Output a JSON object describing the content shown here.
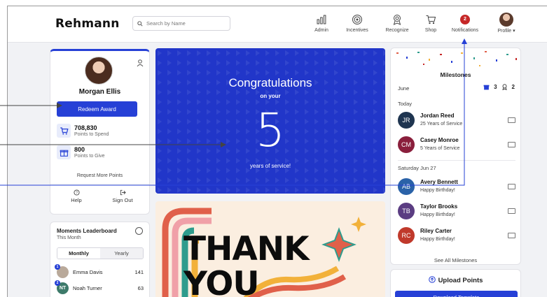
{
  "brand": {
    "logo": "Rehmann",
    "accent": "#2640d6"
  },
  "search": {
    "placeholder": "Search by Name"
  },
  "nav": [
    {
      "label": "Admin",
      "icon": "bar-chart-icon"
    },
    {
      "label": "Incentives",
      "icon": "target-icon"
    },
    {
      "label": "Recognize",
      "icon": "award-icon"
    },
    {
      "label": "Shop",
      "icon": "cart-icon"
    },
    {
      "label": "Notifications",
      "icon": "notification-badge",
      "badge": "2"
    },
    {
      "label": "Profile ▾",
      "icon": "avatar"
    }
  ],
  "profile": {
    "name": "Morgan Ellis",
    "redeem_label": "Redeem Award",
    "points_spend": "708,830",
    "points_spend_label": "Points to Spend",
    "points_give": "800",
    "points_give_label": "Points to Give",
    "request_link": "Request More Points",
    "help_label": "Help",
    "signout_label": "Sign Out"
  },
  "leaderboard": {
    "title": "Moments Leaderboard",
    "period": "This Month",
    "tabs": [
      "Monthly",
      "Yearly"
    ],
    "rows": [
      {
        "rank": "1",
        "name": "Emma Davis",
        "score": "141",
        "initials": "",
        "color": "#b9a99a"
      },
      {
        "rank": "2",
        "name": "Noah Turner",
        "score": "63",
        "initials": "NT",
        "color": "#3d7a6a"
      }
    ]
  },
  "congrats": {
    "title": "Congratulations",
    "on_your": "on your",
    "number": "5",
    "years": "years of service!"
  },
  "thank_you": {
    "line1": "THANK",
    "line2": "YOU"
  },
  "milestones": {
    "title": "Milestones",
    "month": "June",
    "gift_count": "3",
    "award_count": "2",
    "today_label": "Today",
    "later_label": "Saturday Jun 27",
    "today": [
      {
        "initials": "JR",
        "name": "Jordan Reed",
        "detail": "25 Years of Service",
        "color": "#1f3550"
      },
      {
        "initials": "CM",
        "name": "Casey Monroe",
        "detail": "5 Years of Service",
        "color": "#8a1f3c"
      }
    ],
    "later": [
      {
        "initials": "AB",
        "name": "Avery Bennett",
        "detail": "Happy Birthday!",
        "color": "#2a62a8"
      },
      {
        "initials": "TB",
        "name": "Taylor Brooks",
        "detail": "Happy Birthday!",
        "color": "#5b3d82"
      },
      {
        "initials": "RC",
        "name": "Riley Carter",
        "detail": "Happy Birthday!",
        "color": "#c0392b"
      }
    ],
    "see_all": "See All Milestones"
  },
  "upload": {
    "title": "Upload Points",
    "button": "Download Template"
  }
}
